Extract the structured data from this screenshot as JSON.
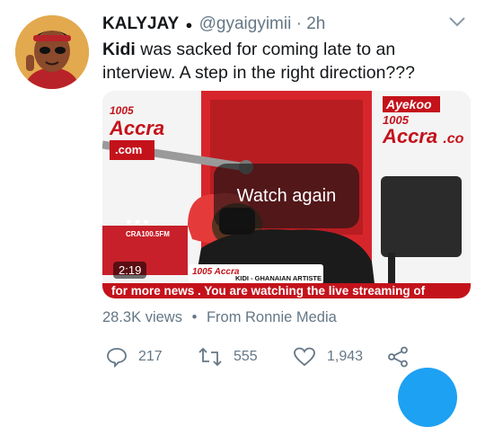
{
  "tweet": {
    "author_name": "KALYJAY",
    "verified_glyph": "●",
    "handle": "@gyaigyimii",
    "separator": "·",
    "time": "2h",
    "text_bold": "Kidi",
    "text_rest": " was sacked for coming late to an interview. A step in the right direction???"
  },
  "media": {
    "overlay_label": "Watch again",
    "duration": "2:19",
    "ticker": "for more news . You are watching the live streaming of",
    "lower_third": "KIDI - GHANAIAN ARTISTE",
    "lower_brand": "1005 Accra",
    "brand_left_num": "1005",
    "brand_left_name": "Accra",
    "brand_left_com": ".com",
    "brand_right_tag": "Ayekoo",
    "brand_right_num": "1005",
    "brand_right_name": "Accra",
    "brand_right_co": ".co",
    "station_handle": "CRA100.5FM"
  },
  "meta": {
    "views": "28.3K views",
    "dot": "•",
    "source": "From Ronnie Media"
  },
  "actions": {
    "replies": "217",
    "retweets": "555",
    "likes": "1,943"
  },
  "colors": {
    "text_primary": "#14171a",
    "text_secondary": "#657786",
    "accent": "#1da1f2",
    "station_red": "#c4121b"
  },
  "icons": [
    "chevron-down-icon",
    "reply-icon",
    "retweet-icon",
    "like-icon",
    "share-icon",
    "compose-fab-icon"
  ]
}
